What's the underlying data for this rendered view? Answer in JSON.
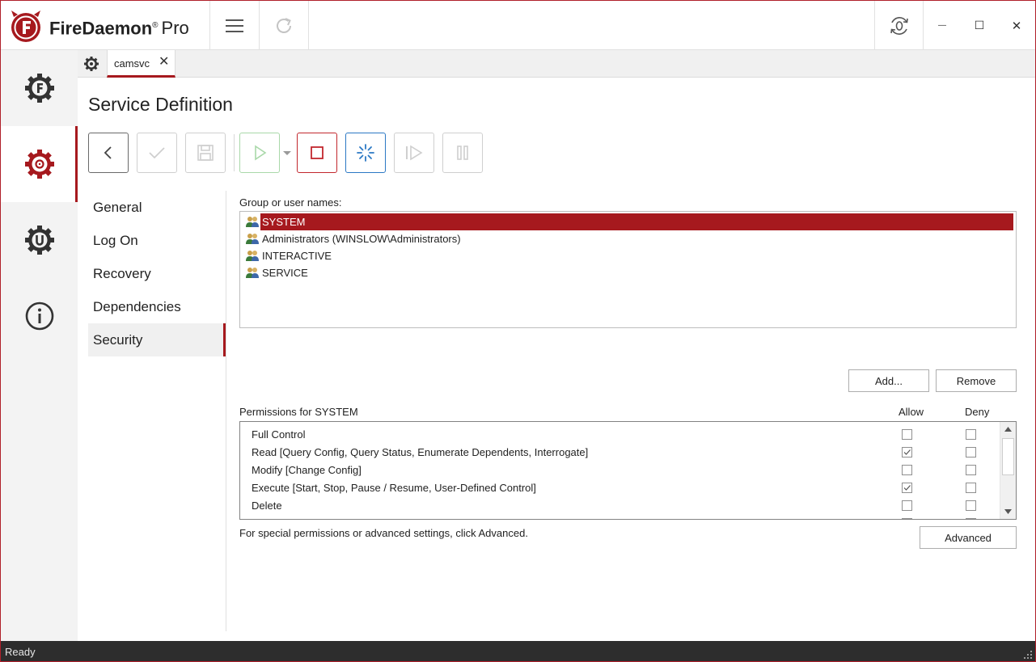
{
  "app": {
    "brand_name": "FireDaemon",
    "brand_suffix": "Pro",
    "reg_mark": "®",
    "brand_color": "#a6191e"
  },
  "titlebar": {
    "menu_icon": "hamburger-icon",
    "refresh_icon": "refresh-icon",
    "session_icon": "session-zero-icon",
    "minimize": "—",
    "maximize": "☐",
    "close": "✕"
  },
  "leftnav": {
    "items": [
      {
        "icon": "firedaemon-gear-icon",
        "active": false
      },
      {
        "icon": "services-gear-icon",
        "active": true
      },
      {
        "icon": "utilities-gear-icon",
        "active": false
      },
      {
        "icon": "info-icon",
        "active": false
      }
    ]
  },
  "tabs": {
    "home_icon": "settings-gear-icon",
    "items": [
      {
        "label": "camsvc",
        "close": "✕"
      }
    ]
  },
  "page": {
    "title": "Service Definition"
  },
  "toolbar": {
    "buttons": [
      {
        "icon": "back-icon",
        "enabled": true
      },
      {
        "icon": "apply-check-icon",
        "enabled": false
      },
      {
        "icon": "save-icon",
        "enabled": false
      },
      {
        "icon": "start-play-icon",
        "enabled": false
      },
      {
        "icon": "stop-icon",
        "enabled": true
      },
      {
        "icon": "restart-spinner-icon",
        "enabled": true
      },
      {
        "icon": "resume-icon",
        "enabled": false
      },
      {
        "icon": "pause-icon",
        "enabled": false
      }
    ]
  },
  "sections": {
    "items": [
      "General",
      "Log On",
      "Recovery",
      "Dependencies",
      "Security"
    ],
    "active": "Security"
  },
  "security": {
    "group_label": "Group or user names:",
    "users": [
      {
        "name": "SYSTEM",
        "selected": true
      },
      {
        "name": "Administrators (WINSLOW\\Administrators)",
        "selected": false
      },
      {
        "name": "INTERACTIVE",
        "selected": false
      },
      {
        "name": "SERVICE",
        "selected": false
      }
    ],
    "add_label": "Add...",
    "remove_label": "Remove",
    "permissions_label": "Permissions for SYSTEM",
    "allow_header": "Allow",
    "deny_header": "Deny",
    "permissions": [
      {
        "name": "Full Control",
        "allow": false,
        "deny": false
      },
      {
        "name": "Read [Query Config, Query Status, Enumerate Dependents, Interrogate]",
        "allow": true,
        "deny": false
      },
      {
        "name": "Modify [Change Config]",
        "allow": false,
        "deny": false
      },
      {
        "name": "Execute [Start, Stop, Pause / Resume, User-Defined Control]",
        "allow": true,
        "deny": false
      },
      {
        "name": "Delete",
        "allow": false,
        "deny": false
      }
    ],
    "advanced_hint": "For special permissions or advanced settings, click Advanced.",
    "advanced_label": "Advanced"
  },
  "status": {
    "text": "Ready"
  }
}
